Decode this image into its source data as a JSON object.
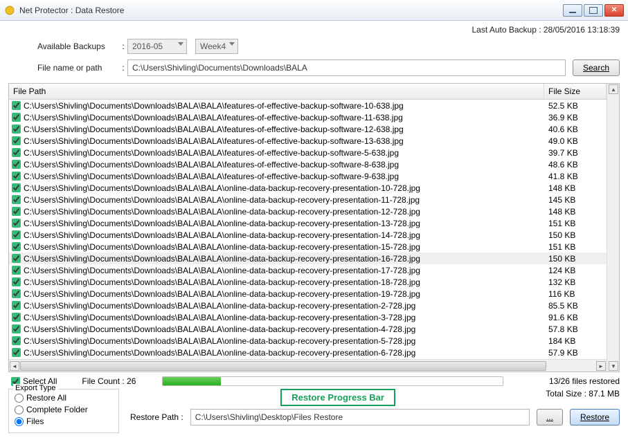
{
  "window": {
    "title": "Net Protector : Data Restore"
  },
  "header": {
    "last_backup_label": "Last Auto Backup : 28/05/2016 13:18:39"
  },
  "filters": {
    "available_label": "Available Backups",
    "month": "2016-05",
    "week": "Week4",
    "path_label": "File name or path",
    "path_value": "C:\\Users\\Shivling\\Documents\\Downloads\\BALA",
    "search": "Search"
  },
  "table": {
    "col_path": "File Path",
    "col_size": "File Size",
    "rows": [
      {
        "path": "C:\\Users\\Shivling\\Documents\\Downloads\\BALA\\BALA\\features-of-effective-backup-software-10-638.jpg",
        "size": "52.5 KB"
      },
      {
        "path": "C:\\Users\\Shivling\\Documents\\Downloads\\BALA\\BALA\\features-of-effective-backup-software-11-638.jpg",
        "size": "36.9 KB"
      },
      {
        "path": "C:\\Users\\Shivling\\Documents\\Downloads\\BALA\\BALA\\features-of-effective-backup-software-12-638.jpg",
        "size": "40.6 KB"
      },
      {
        "path": "C:\\Users\\Shivling\\Documents\\Downloads\\BALA\\BALA\\features-of-effective-backup-software-13-638.jpg",
        "size": "49.0 KB"
      },
      {
        "path": "C:\\Users\\Shivling\\Documents\\Downloads\\BALA\\BALA\\features-of-effective-backup-software-5-638.jpg",
        "size": "39.7 KB"
      },
      {
        "path": "C:\\Users\\Shivling\\Documents\\Downloads\\BALA\\BALA\\features-of-effective-backup-software-8-638.jpg",
        "size": "48.6 KB"
      },
      {
        "path": "C:\\Users\\Shivling\\Documents\\Downloads\\BALA\\BALA\\features-of-effective-backup-software-9-638.jpg",
        "size": "41.8 KB"
      },
      {
        "path": "C:\\Users\\Shivling\\Documents\\Downloads\\BALA\\BALA\\online-data-backup-recovery-presentation-10-728.jpg",
        "size": "148 KB"
      },
      {
        "path": "C:\\Users\\Shivling\\Documents\\Downloads\\BALA\\BALA\\online-data-backup-recovery-presentation-11-728.jpg",
        "size": "145 KB"
      },
      {
        "path": "C:\\Users\\Shivling\\Documents\\Downloads\\BALA\\BALA\\online-data-backup-recovery-presentation-12-728.jpg",
        "size": "148 KB"
      },
      {
        "path": "C:\\Users\\Shivling\\Documents\\Downloads\\BALA\\BALA\\online-data-backup-recovery-presentation-13-728.jpg",
        "size": "151 KB"
      },
      {
        "path": "C:\\Users\\Shivling\\Documents\\Downloads\\BALA\\BALA\\online-data-backup-recovery-presentation-14-728.jpg",
        "size": "150 KB"
      },
      {
        "path": "C:\\Users\\Shivling\\Documents\\Downloads\\BALA\\BALA\\online-data-backup-recovery-presentation-15-728.jpg",
        "size": "151 KB"
      },
      {
        "path": "C:\\Users\\Shivling\\Documents\\Downloads\\BALA\\BALA\\online-data-backup-recovery-presentation-16-728.jpg",
        "size": "150 KB",
        "sel": true
      },
      {
        "path": "C:\\Users\\Shivling\\Documents\\Downloads\\BALA\\BALA\\online-data-backup-recovery-presentation-17-728.jpg",
        "size": "124 KB"
      },
      {
        "path": "C:\\Users\\Shivling\\Documents\\Downloads\\BALA\\BALA\\online-data-backup-recovery-presentation-18-728.jpg",
        "size": "132 KB"
      },
      {
        "path": "C:\\Users\\Shivling\\Documents\\Downloads\\BALA\\BALA\\online-data-backup-recovery-presentation-19-728.jpg",
        "size": "116 KB"
      },
      {
        "path": "C:\\Users\\Shivling\\Documents\\Downloads\\BALA\\BALA\\online-data-backup-recovery-presentation-2-728.jpg",
        "size": "85.5 KB"
      },
      {
        "path": "C:\\Users\\Shivling\\Documents\\Downloads\\BALA\\BALA\\online-data-backup-recovery-presentation-3-728.jpg",
        "size": "91.6 KB"
      },
      {
        "path": "C:\\Users\\Shivling\\Documents\\Downloads\\BALA\\BALA\\online-data-backup-recovery-presentation-4-728.jpg",
        "size": "57.8 KB"
      },
      {
        "path": "C:\\Users\\Shivling\\Documents\\Downloads\\BALA\\BALA\\online-data-backup-recovery-presentation-5-728.jpg",
        "size": "184 KB"
      },
      {
        "path": "C:\\Users\\Shivling\\Documents\\Downloads\\BALA\\BALA\\online-data-backup-recovery-presentation-6-728.jpg",
        "size": "57.9 KB"
      }
    ]
  },
  "bottom": {
    "select_all": "Select All",
    "file_count_label": "File Count : 26",
    "restored_label": "13/26 files restored",
    "progress_percent": 17,
    "export_legend": "Export Type",
    "radio_all": "Restore All",
    "radio_folder": "Complete Folder",
    "radio_files": "Files",
    "callout": "Restore Progress Bar",
    "total_label": "Total Size :  87.1 MB",
    "restore_path_label": "Restore Path   :",
    "restore_path": "C:\\Users\\Shivling\\Desktop\\Files Restore",
    "browse": "...",
    "restore": "Restore"
  }
}
